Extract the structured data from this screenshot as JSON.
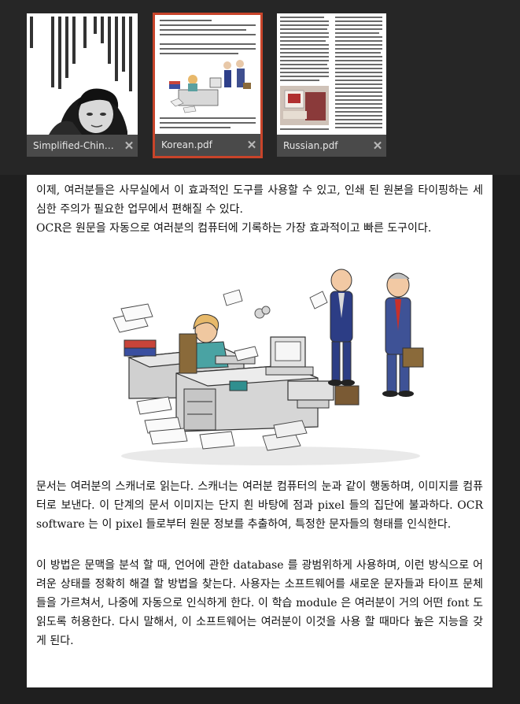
{
  "tabs": [
    {
      "label": "Simplified-Chin…",
      "close": "✕",
      "selected": false
    },
    {
      "label": "Korean.pdf",
      "close": "✕",
      "selected": true
    },
    {
      "label": "Russian.pdf",
      "close": "✕",
      "selected": false
    }
  ],
  "document": {
    "paragraphs": [
      "이제, 여러분들은 사무실에서 이 효과적인 도구를 사용할 수 있고, 인쇄 된 원본을 타이핑하는 세심한 주의가 필요한 업무에서 편해질 수 있다.",
      "OCR은 원문을 자동으로 여러분의 컴퓨터에 기록하는 가장 효과적이고 빠른 도구이다.",
      "문서는 여러분의 스캐너로 읽는다. 스캐너는 여러분 컴퓨터의 눈과 같이 행동하며, 이미지를 컴퓨터로 보낸다. 이 단계의 문서 이미지는 단지 흰 바탕에 점과 pixel 들의 집단에 불과하다. OCR software 는 이 pixel 들로부터 원문 정보를 추출하여, 특정한 문자들의 형태를 인식한다.",
      "이 방법은 문맥을 분석 할 때, 언어에 관한 database 를 광범위하게 사용하며, 이런 방식으로 어려운 상태를 정확히 해결 할 방법을 찾는다. 사용자는 소프트웨어를 새로운 문자들과 타이프 문체들을 가르쳐서, 나중에 자동으로 인식하게 한다. 이 학습 module 은 여러분이 거의 어떤 font 도 읽도록 허용한다. 다시 말해서, 이 소프트웨어는 여러분이 이것을 사용 할 때마다 높은 지능을 갖게 된다."
    ]
  },
  "colors": {
    "selected_border": "#c8442a",
    "tab_bar": "#4a4a4a",
    "background": "#1f1f1f"
  }
}
